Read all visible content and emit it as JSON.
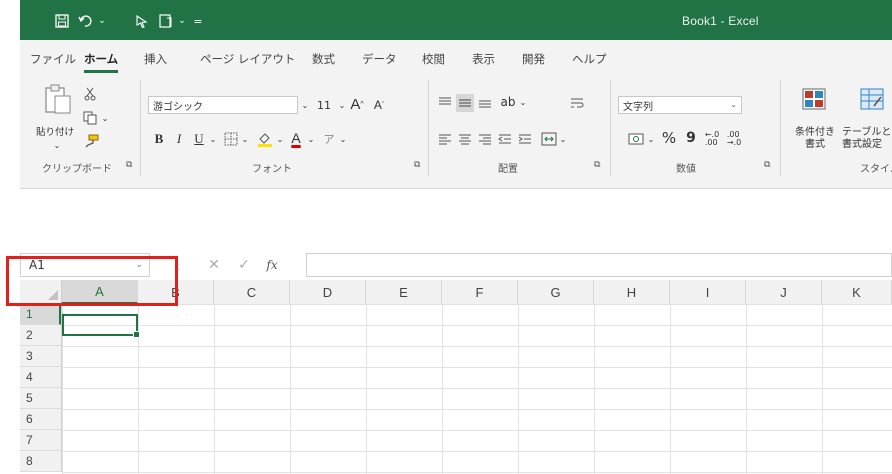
{
  "window": {
    "title": "Book1  -  Excel",
    "accent": "#217346"
  },
  "qat": {
    "save_icon": "save-icon",
    "undo_icon": "undo-icon",
    "touch_icon": "touch-mode-icon",
    "redo_icon": "redo-icon",
    "customize_icon": "customize-icon"
  },
  "tabs": [
    "ファイル",
    "ホーム",
    "挿入",
    "ページ レイアウト",
    "数式",
    "データ",
    "校閲",
    "表示",
    "開発",
    "ヘルプ"
  ],
  "active_tab": "ホーム",
  "ribbon": {
    "clipboard": {
      "paste_label": "貼り付け",
      "group_label": "クリップボード"
    },
    "font": {
      "font_name": "游ゴシック",
      "font_size": "11",
      "group_label": "フォント"
    },
    "alignment": {
      "group_label": "配置"
    },
    "number": {
      "format": "文字列",
      "percent": "%",
      "comma": "9",
      "group_label": "数値"
    },
    "styles": {
      "conditional": "条件付き",
      "conditional2": "書式",
      "table": "テーブルと",
      "table2": "書式設定",
      "group_label": "スタイル"
    }
  },
  "formula_bar": {
    "name_box": "A1",
    "fx": "fx",
    "cancel": "✕",
    "enter": "✓",
    "value": ""
  },
  "grid": {
    "columns": [
      "A",
      "B",
      "C",
      "D",
      "E",
      "F",
      "G",
      "H",
      "I",
      "J",
      "K"
    ],
    "rows": [
      "1",
      "2",
      "3",
      "4",
      "5",
      "6",
      "7",
      "8"
    ],
    "active_cell": "A1",
    "highlight_color": "#e0201b"
  }
}
